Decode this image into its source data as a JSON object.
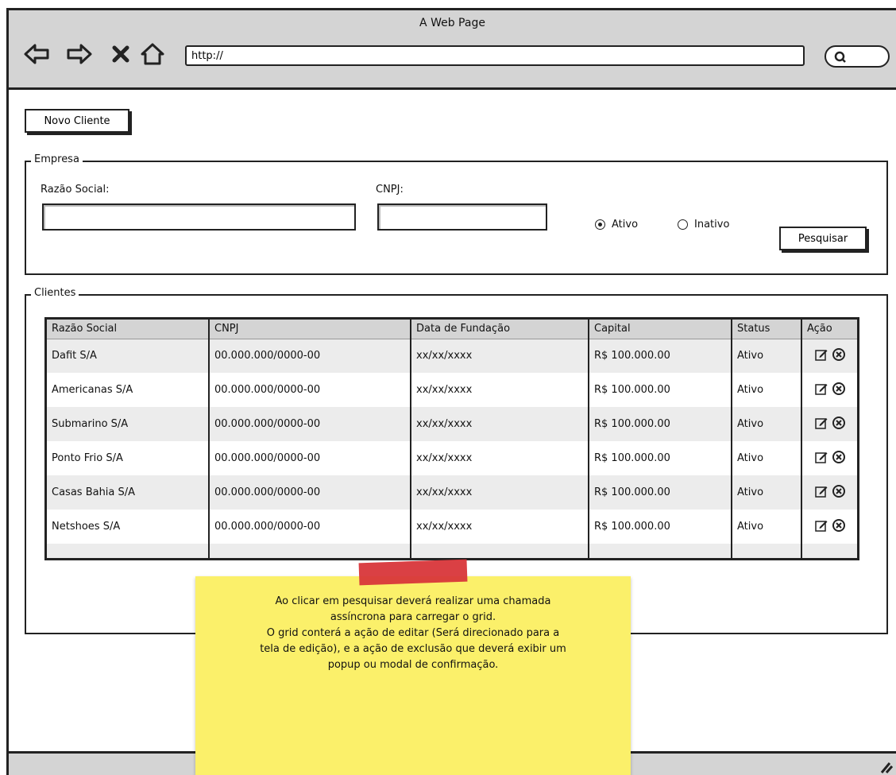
{
  "browser": {
    "title": "A Web Page",
    "url_placeholder": "http://"
  },
  "toolbar": {
    "new_client_label": "Novo Cliente"
  },
  "empresa": {
    "legend": "Empresa",
    "razao_label": "Razão Social:",
    "cnpj_label": "CNPJ:",
    "radio_active": "Ativo",
    "radio_inactive": "Inativo",
    "selected": "Ativo",
    "search_label": "Pesquisar"
  },
  "clientes": {
    "legend": "Clientes",
    "columns": [
      "Razão Social",
      "CNPJ",
      "Data de Fundação",
      "Capital",
      "Status",
      "Ação"
    ],
    "rows": [
      {
        "razao": "Dafit S/A",
        "cnpj": "00.000.000/0000-00",
        "data": "xx/xx/xxxx",
        "capital": "R$ 100.000.00",
        "status": "Ativo"
      },
      {
        "razao": "Americanas S/A",
        "cnpj": "00.000.000/0000-00",
        "data": "xx/xx/xxxx",
        "capital": "R$ 100.000.00",
        "status": "Ativo"
      },
      {
        "razao": "Submarino S/A",
        "cnpj": "00.000.000/0000-00",
        "data": "xx/xx/xxxx",
        "capital": "R$ 100.000.00",
        "status": "Ativo"
      },
      {
        "razao": "Ponto Frio S/A",
        "cnpj": "00.000.000/0000-00",
        "data": "xx/xx/xxxx",
        "capital": "R$ 100.000.00",
        "status": "Ativo"
      },
      {
        "razao": "Casas Bahia S/A",
        "cnpj": "00.000.000/0000-00",
        "data": "xx/xx/xxxx",
        "capital": "R$ 100.000.00",
        "status": "Ativo"
      },
      {
        "razao": "Netshoes S/A",
        "cnpj": "00.000.000/0000-00",
        "data": "xx/xx/xxxx",
        "capital": "R$ 100.000.00",
        "status": "Ativo"
      }
    ],
    "action_icons": [
      "edit-icon",
      "delete-icon"
    ]
  },
  "note": {
    "lines": [
      "Ao clicar em pesquisar deverá realizar uma chamada",
      "assíncrona para carregar o grid.",
      "O grid conterá a ação de editar (Será direcionado para a",
      "tela de edição), e a ação de exclusão que deverá exibir um",
      "popup ou modal de confirmação."
    ],
    "color": "#fbf06a",
    "tape_color": "#d8363a"
  }
}
